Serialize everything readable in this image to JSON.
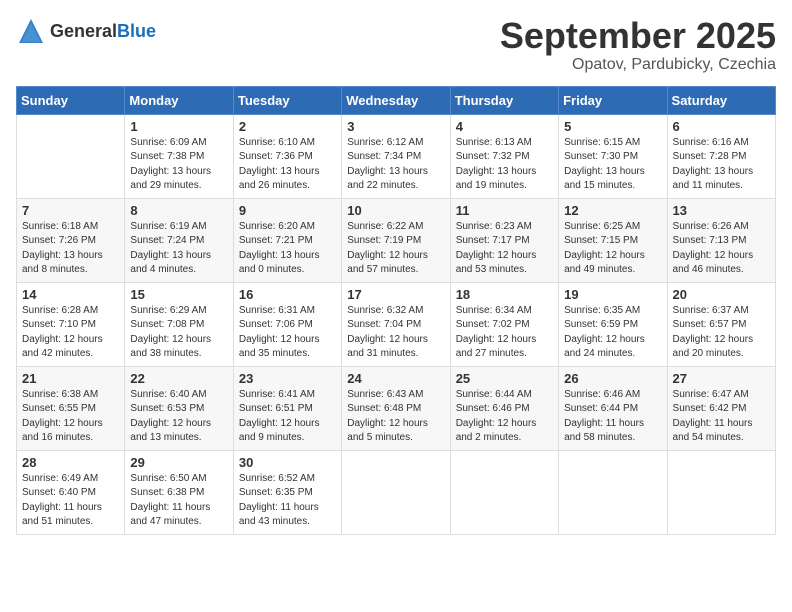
{
  "logo": {
    "general": "General",
    "blue": "Blue"
  },
  "header": {
    "month": "September 2025",
    "location": "Opatov, Pardubicky, Czechia"
  },
  "weekdays": [
    "Sunday",
    "Monday",
    "Tuesday",
    "Wednesday",
    "Thursday",
    "Friday",
    "Saturday"
  ],
  "weeks": [
    [
      {
        "day": "",
        "info": ""
      },
      {
        "day": "1",
        "info": "Sunrise: 6:09 AM\nSunset: 7:38 PM\nDaylight: 13 hours\nand 29 minutes."
      },
      {
        "day": "2",
        "info": "Sunrise: 6:10 AM\nSunset: 7:36 PM\nDaylight: 13 hours\nand 26 minutes."
      },
      {
        "day": "3",
        "info": "Sunrise: 6:12 AM\nSunset: 7:34 PM\nDaylight: 13 hours\nand 22 minutes."
      },
      {
        "day": "4",
        "info": "Sunrise: 6:13 AM\nSunset: 7:32 PM\nDaylight: 13 hours\nand 19 minutes."
      },
      {
        "day": "5",
        "info": "Sunrise: 6:15 AM\nSunset: 7:30 PM\nDaylight: 13 hours\nand 15 minutes."
      },
      {
        "day": "6",
        "info": "Sunrise: 6:16 AM\nSunset: 7:28 PM\nDaylight: 13 hours\nand 11 minutes."
      }
    ],
    [
      {
        "day": "7",
        "info": "Sunrise: 6:18 AM\nSunset: 7:26 PM\nDaylight: 13 hours\nand 8 minutes."
      },
      {
        "day": "8",
        "info": "Sunrise: 6:19 AM\nSunset: 7:24 PM\nDaylight: 13 hours\nand 4 minutes."
      },
      {
        "day": "9",
        "info": "Sunrise: 6:20 AM\nSunset: 7:21 PM\nDaylight: 13 hours\nand 0 minutes."
      },
      {
        "day": "10",
        "info": "Sunrise: 6:22 AM\nSunset: 7:19 PM\nDaylight: 12 hours\nand 57 minutes."
      },
      {
        "day": "11",
        "info": "Sunrise: 6:23 AM\nSunset: 7:17 PM\nDaylight: 12 hours\nand 53 minutes."
      },
      {
        "day": "12",
        "info": "Sunrise: 6:25 AM\nSunset: 7:15 PM\nDaylight: 12 hours\nand 49 minutes."
      },
      {
        "day": "13",
        "info": "Sunrise: 6:26 AM\nSunset: 7:13 PM\nDaylight: 12 hours\nand 46 minutes."
      }
    ],
    [
      {
        "day": "14",
        "info": "Sunrise: 6:28 AM\nSunset: 7:10 PM\nDaylight: 12 hours\nand 42 minutes."
      },
      {
        "day": "15",
        "info": "Sunrise: 6:29 AM\nSunset: 7:08 PM\nDaylight: 12 hours\nand 38 minutes."
      },
      {
        "day": "16",
        "info": "Sunrise: 6:31 AM\nSunset: 7:06 PM\nDaylight: 12 hours\nand 35 minutes."
      },
      {
        "day": "17",
        "info": "Sunrise: 6:32 AM\nSunset: 7:04 PM\nDaylight: 12 hours\nand 31 minutes."
      },
      {
        "day": "18",
        "info": "Sunrise: 6:34 AM\nSunset: 7:02 PM\nDaylight: 12 hours\nand 27 minutes."
      },
      {
        "day": "19",
        "info": "Sunrise: 6:35 AM\nSunset: 6:59 PM\nDaylight: 12 hours\nand 24 minutes."
      },
      {
        "day": "20",
        "info": "Sunrise: 6:37 AM\nSunset: 6:57 PM\nDaylight: 12 hours\nand 20 minutes."
      }
    ],
    [
      {
        "day": "21",
        "info": "Sunrise: 6:38 AM\nSunset: 6:55 PM\nDaylight: 12 hours\nand 16 minutes."
      },
      {
        "day": "22",
        "info": "Sunrise: 6:40 AM\nSunset: 6:53 PM\nDaylight: 12 hours\nand 13 minutes."
      },
      {
        "day": "23",
        "info": "Sunrise: 6:41 AM\nSunset: 6:51 PM\nDaylight: 12 hours\nand 9 minutes."
      },
      {
        "day": "24",
        "info": "Sunrise: 6:43 AM\nSunset: 6:48 PM\nDaylight: 12 hours\nand 5 minutes."
      },
      {
        "day": "25",
        "info": "Sunrise: 6:44 AM\nSunset: 6:46 PM\nDaylight: 12 hours\nand 2 minutes."
      },
      {
        "day": "26",
        "info": "Sunrise: 6:46 AM\nSunset: 6:44 PM\nDaylight: 11 hours\nand 58 minutes."
      },
      {
        "day": "27",
        "info": "Sunrise: 6:47 AM\nSunset: 6:42 PM\nDaylight: 11 hours\nand 54 minutes."
      }
    ],
    [
      {
        "day": "28",
        "info": "Sunrise: 6:49 AM\nSunset: 6:40 PM\nDaylight: 11 hours\nand 51 minutes."
      },
      {
        "day": "29",
        "info": "Sunrise: 6:50 AM\nSunset: 6:38 PM\nDaylight: 11 hours\nand 47 minutes."
      },
      {
        "day": "30",
        "info": "Sunrise: 6:52 AM\nSunset: 6:35 PM\nDaylight: 11 hours\nand 43 minutes."
      },
      {
        "day": "",
        "info": ""
      },
      {
        "day": "",
        "info": ""
      },
      {
        "day": "",
        "info": ""
      },
      {
        "day": "",
        "info": ""
      }
    ]
  ]
}
